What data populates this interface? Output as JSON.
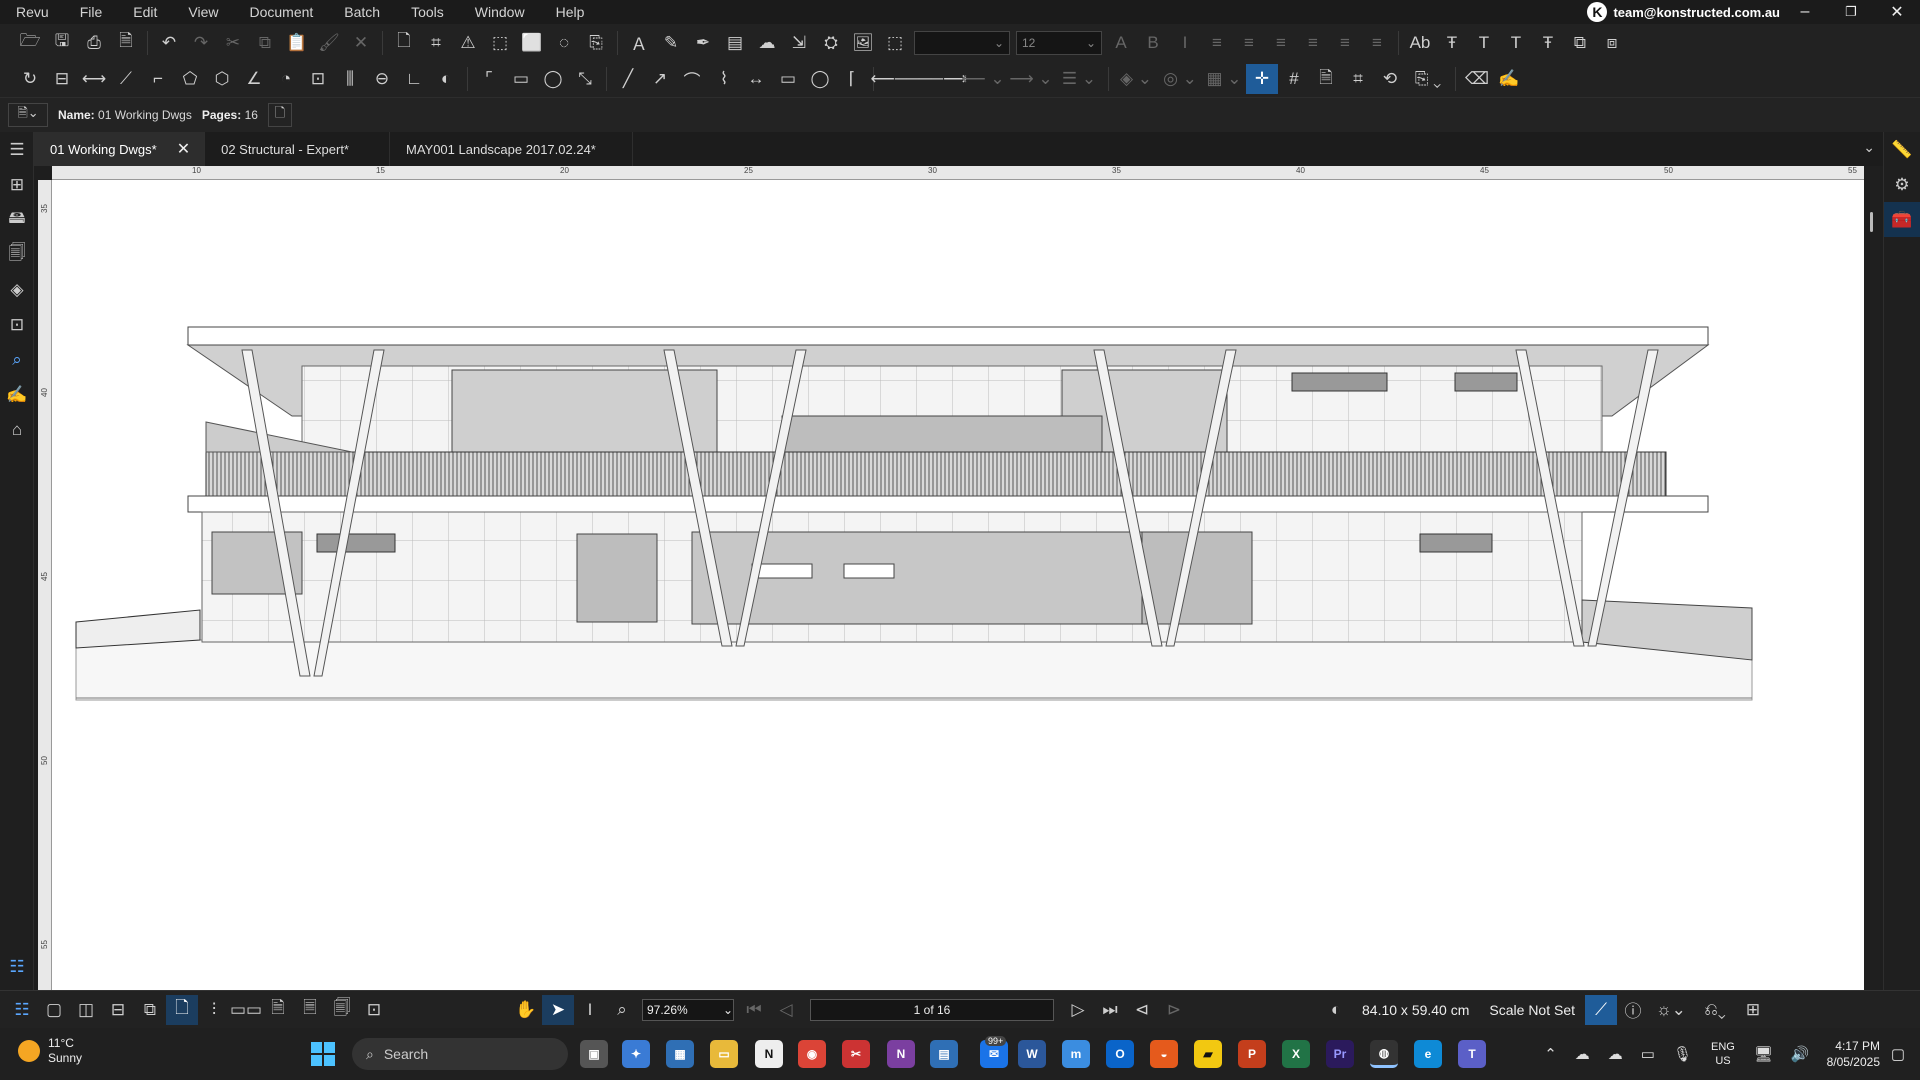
{
  "menu": [
    "Revu",
    "File",
    "Edit",
    "View",
    "Document",
    "Batch",
    "Tools",
    "Window",
    "Help"
  ],
  "account": {
    "email": "team@konstructed.com.au",
    "logo_icon": "konstructed-logo-icon"
  },
  "window_controls": {
    "minimize": "–",
    "restore": "❐",
    "close": "✕"
  },
  "toolbar1": {
    "font_name": "",
    "font_size": "12"
  },
  "properties": {
    "name_label": "Name:",
    "name_value": "01 Working Dwgs",
    "pages_label": "Pages:",
    "pages_value": "16"
  },
  "tabs": [
    {
      "label": "01 Working Dwgs*",
      "active": true
    },
    {
      "label": "02 Structural - Expert*",
      "active": false
    },
    {
      "label": "MAY001 Landscape 2017.02.24*",
      "active": false
    }
  ],
  "ruler_top": [
    "10",
    "15",
    "20",
    "25",
    "30",
    "35",
    "40",
    "45",
    "50",
    "55"
  ],
  "ruler_left": [
    "35",
    "40",
    "45",
    "50",
    "55"
  ],
  "status": {
    "zoom": "97.26%",
    "page": "1 of 16",
    "size": "84.10 x 59.40 cm",
    "scale": "Scale Not Set"
  },
  "weather": {
    "temp": "11°C",
    "desc": "Sunny"
  },
  "taskbar": {
    "search": "Search",
    "mail_badge": "99+"
  },
  "tray": {
    "lang1": "ENG",
    "lang2": "US",
    "time": "4:17 PM",
    "date": "8/05/2025"
  },
  "colors": {
    "accent": "#1f5c99",
    "highlight": "#5aa7ff",
    "bg": "#1e1e1e"
  }
}
